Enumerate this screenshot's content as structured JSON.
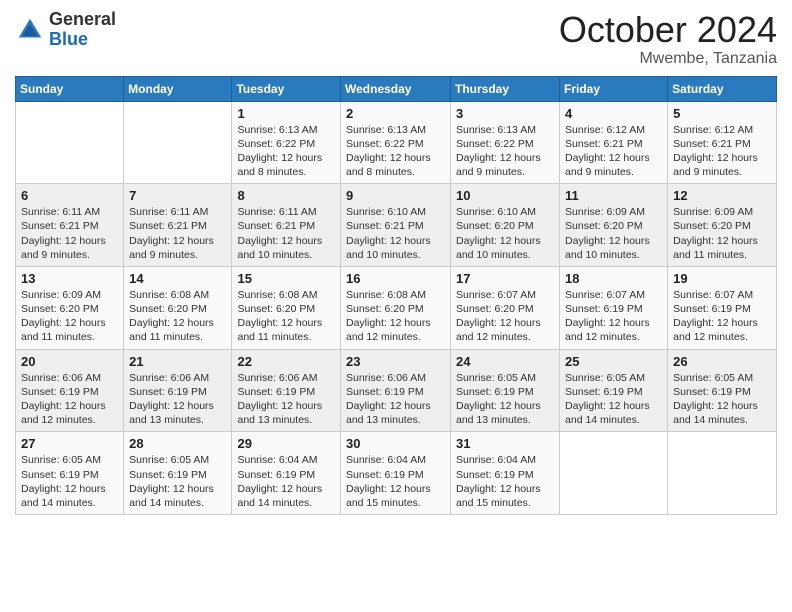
{
  "header": {
    "logo_general": "General",
    "logo_blue": "Blue",
    "title": "October 2024",
    "location": "Mwembe, Tanzania"
  },
  "days_of_week": [
    "Sunday",
    "Monday",
    "Tuesday",
    "Wednesday",
    "Thursday",
    "Friday",
    "Saturday"
  ],
  "weeks": [
    [
      {
        "day": "",
        "sunrise": "",
        "sunset": "",
        "daylight": ""
      },
      {
        "day": "",
        "sunrise": "",
        "sunset": "",
        "daylight": ""
      },
      {
        "day": "1",
        "sunrise": "Sunrise: 6:13 AM",
        "sunset": "Sunset: 6:22 PM",
        "daylight": "Daylight: 12 hours and 8 minutes."
      },
      {
        "day": "2",
        "sunrise": "Sunrise: 6:13 AM",
        "sunset": "Sunset: 6:22 PM",
        "daylight": "Daylight: 12 hours and 8 minutes."
      },
      {
        "day": "3",
        "sunrise": "Sunrise: 6:13 AM",
        "sunset": "Sunset: 6:22 PM",
        "daylight": "Daylight: 12 hours and 9 minutes."
      },
      {
        "day": "4",
        "sunrise": "Sunrise: 6:12 AM",
        "sunset": "Sunset: 6:21 PM",
        "daylight": "Daylight: 12 hours and 9 minutes."
      },
      {
        "day": "5",
        "sunrise": "Sunrise: 6:12 AM",
        "sunset": "Sunset: 6:21 PM",
        "daylight": "Daylight: 12 hours and 9 minutes."
      }
    ],
    [
      {
        "day": "6",
        "sunrise": "Sunrise: 6:11 AM",
        "sunset": "Sunset: 6:21 PM",
        "daylight": "Daylight: 12 hours and 9 minutes."
      },
      {
        "day": "7",
        "sunrise": "Sunrise: 6:11 AM",
        "sunset": "Sunset: 6:21 PM",
        "daylight": "Daylight: 12 hours and 9 minutes."
      },
      {
        "day": "8",
        "sunrise": "Sunrise: 6:11 AM",
        "sunset": "Sunset: 6:21 PM",
        "daylight": "Daylight: 12 hours and 10 minutes."
      },
      {
        "day": "9",
        "sunrise": "Sunrise: 6:10 AM",
        "sunset": "Sunset: 6:21 PM",
        "daylight": "Daylight: 12 hours and 10 minutes."
      },
      {
        "day": "10",
        "sunrise": "Sunrise: 6:10 AM",
        "sunset": "Sunset: 6:20 PM",
        "daylight": "Daylight: 12 hours and 10 minutes."
      },
      {
        "day": "11",
        "sunrise": "Sunrise: 6:09 AM",
        "sunset": "Sunset: 6:20 PM",
        "daylight": "Daylight: 12 hours and 10 minutes."
      },
      {
        "day": "12",
        "sunrise": "Sunrise: 6:09 AM",
        "sunset": "Sunset: 6:20 PM",
        "daylight": "Daylight: 12 hours and 11 minutes."
      }
    ],
    [
      {
        "day": "13",
        "sunrise": "Sunrise: 6:09 AM",
        "sunset": "Sunset: 6:20 PM",
        "daylight": "Daylight: 12 hours and 11 minutes."
      },
      {
        "day": "14",
        "sunrise": "Sunrise: 6:08 AM",
        "sunset": "Sunset: 6:20 PM",
        "daylight": "Daylight: 12 hours and 11 minutes."
      },
      {
        "day": "15",
        "sunrise": "Sunrise: 6:08 AM",
        "sunset": "Sunset: 6:20 PM",
        "daylight": "Daylight: 12 hours and 11 minutes."
      },
      {
        "day": "16",
        "sunrise": "Sunrise: 6:08 AM",
        "sunset": "Sunset: 6:20 PM",
        "daylight": "Daylight: 12 hours and 12 minutes."
      },
      {
        "day": "17",
        "sunrise": "Sunrise: 6:07 AM",
        "sunset": "Sunset: 6:20 PM",
        "daylight": "Daylight: 12 hours and 12 minutes."
      },
      {
        "day": "18",
        "sunrise": "Sunrise: 6:07 AM",
        "sunset": "Sunset: 6:19 PM",
        "daylight": "Daylight: 12 hours and 12 minutes."
      },
      {
        "day": "19",
        "sunrise": "Sunrise: 6:07 AM",
        "sunset": "Sunset: 6:19 PM",
        "daylight": "Daylight: 12 hours and 12 minutes."
      }
    ],
    [
      {
        "day": "20",
        "sunrise": "Sunrise: 6:06 AM",
        "sunset": "Sunset: 6:19 PM",
        "daylight": "Daylight: 12 hours and 12 minutes."
      },
      {
        "day": "21",
        "sunrise": "Sunrise: 6:06 AM",
        "sunset": "Sunset: 6:19 PM",
        "daylight": "Daylight: 12 hours and 13 minutes."
      },
      {
        "day": "22",
        "sunrise": "Sunrise: 6:06 AM",
        "sunset": "Sunset: 6:19 PM",
        "daylight": "Daylight: 12 hours and 13 minutes."
      },
      {
        "day": "23",
        "sunrise": "Sunrise: 6:06 AM",
        "sunset": "Sunset: 6:19 PM",
        "daylight": "Daylight: 12 hours and 13 minutes."
      },
      {
        "day": "24",
        "sunrise": "Sunrise: 6:05 AM",
        "sunset": "Sunset: 6:19 PM",
        "daylight": "Daylight: 12 hours and 13 minutes."
      },
      {
        "day": "25",
        "sunrise": "Sunrise: 6:05 AM",
        "sunset": "Sunset: 6:19 PM",
        "daylight": "Daylight: 12 hours and 14 minutes."
      },
      {
        "day": "26",
        "sunrise": "Sunrise: 6:05 AM",
        "sunset": "Sunset: 6:19 PM",
        "daylight": "Daylight: 12 hours and 14 minutes."
      }
    ],
    [
      {
        "day": "27",
        "sunrise": "Sunrise: 6:05 AM",
        "sunset": "Sunset: 6:19 PM",
        "daylight": "Daylight: 12 hours and 14 minutes."
      },
      {
        "day": "28",
        "sunrise": "Sunrise: 6:05 AM",
        "sunset": "Sunset: 6:19 PM",
        "daylight": "Daylight: 12 hours and 14 minutes."
      },
      {
        "day": "29",
        "sunrise": "Sunrise: 6:04 AM",
        "sunset": "Sunset: 6:19 PM",
        "daylight": "Daylight: 12 hours and 14 minutes."
      },
      {
        "day": "30",
        "sunrise": "Sunrise: 6:04 AM",
        "sunset": "Sunset: 6:19 PM",
        "daylight": "Daylight: 12 hours and 15 minutes."
      },
      {
        "day": "31",
        "sunrise": "Sunrise: 6:04 AM",
        "sunset": "Sunset: 6:19 PM",
        "daylight": "Daylight: 12 hours and 15 minutes."
      },
      {
        "day": "",
        "sunrise": "",
        "sunset": "",
        "daylight": ""
      },
      {
        "day": "",
        "sunrise": "",
        "sunset": "",
        "daylight": ""
      }
    ]
  ]
}
